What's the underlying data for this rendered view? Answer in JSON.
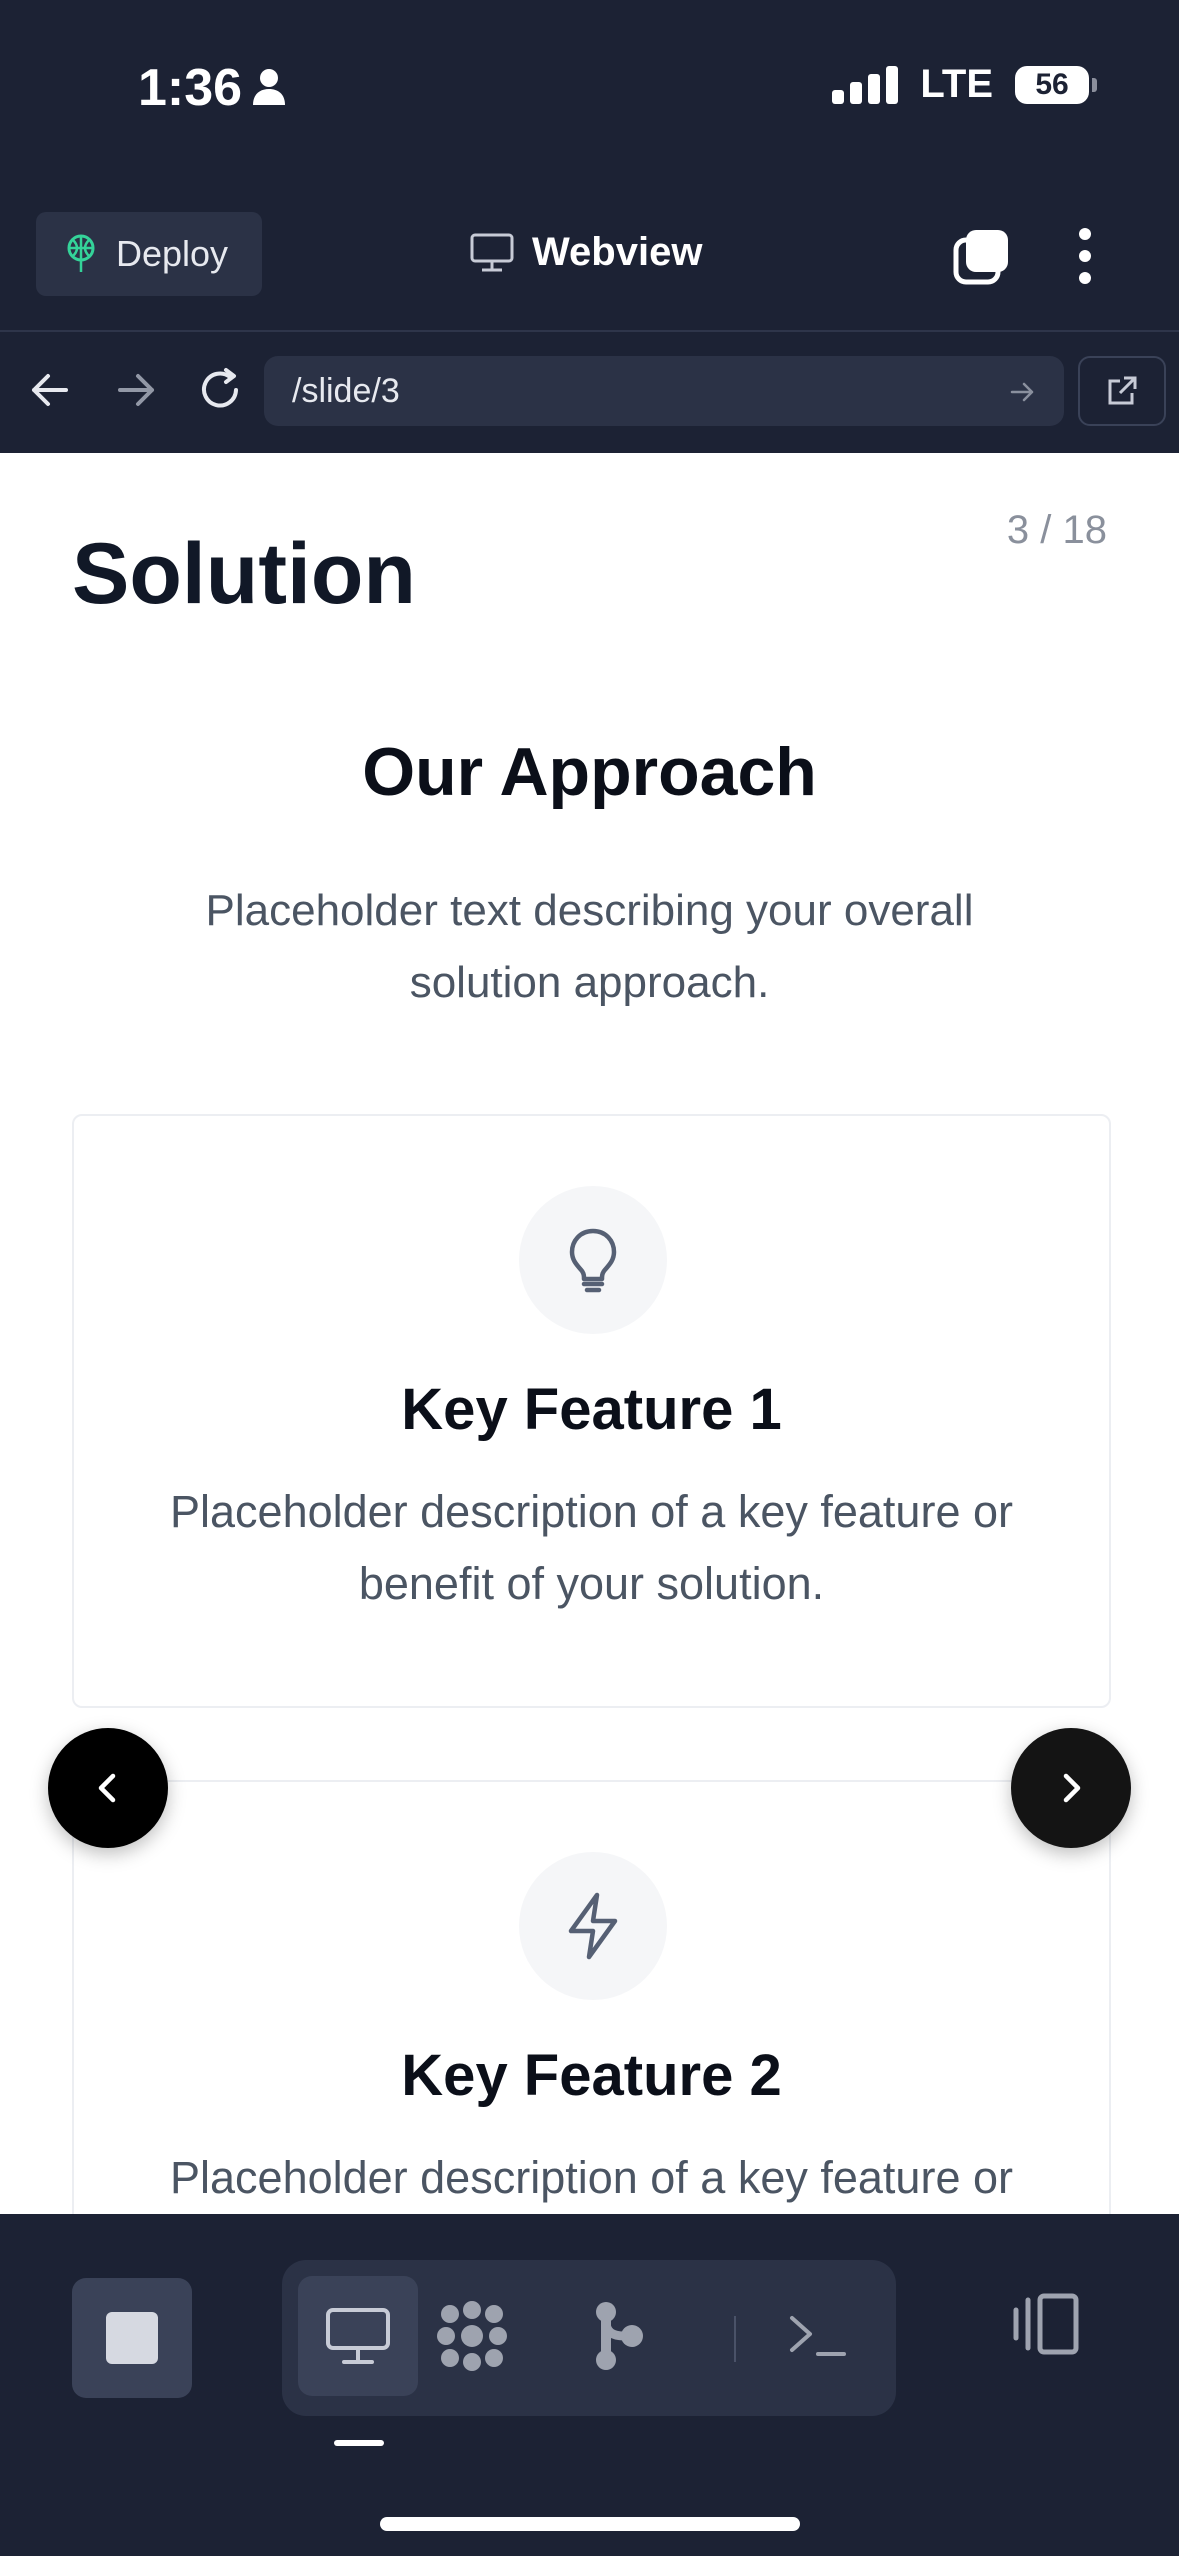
{
  "status_bar": {
    "time": "1:36",
    "network": "LTE",
    "battery": "56"
  },
  "header": {
    "deploy_label": "Deploy",
    "title": "Webview"
  },
  "url_bar": {
    "url": "/slide/3"
  },
  "slide": {
    "counter": "3 / 18",
    "title": "Solution",
    "section_title": "Our Approach",
    "section_desc": "Placeholder text describing your overall solution approach.",
    "cards": [
      {
        "icon": "lightbulb-icon",
        "title": "Key Feature 1",
        "desc": "Placeholder description of a key feature or benefit of your solution."
      },
      {
        "icon": "lightning-icon",
        "title": "Key Feature 2",
        "desc": "Placeholder description of a key feature or benefit of your solution."
      }
    ]
  },
  "colors": {
    "chrome_bg": "#1c2234",
    "field_bg": "#2b3246",
    "active_bg": "#3a4258",
    "deploy_icon": "#34d399"
  },
  "bottom_bar": {
    "tools": [
      "monitor-icon",
      "apps-icon",
      "git-icon",
      "terminal-icon"
    ]
  }
}
